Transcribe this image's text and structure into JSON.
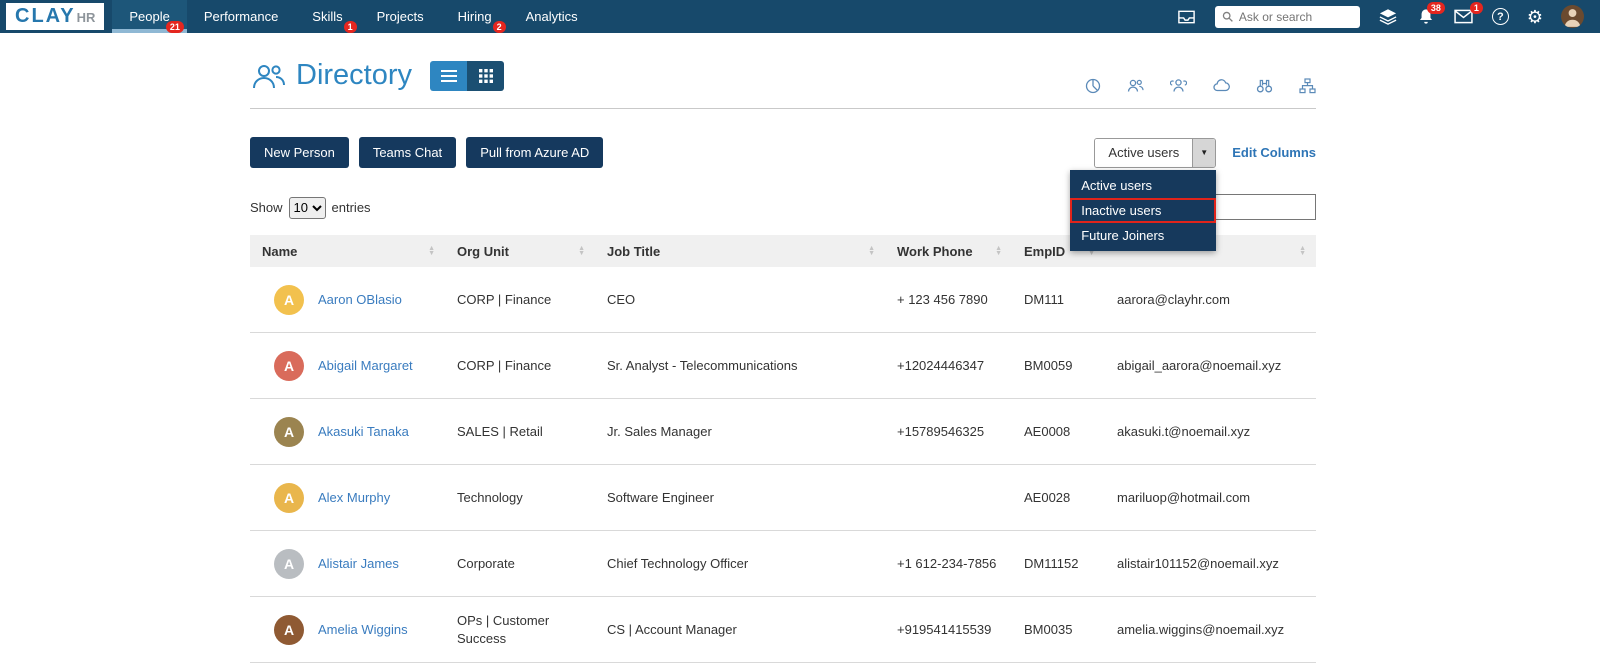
{
  "brand": {
    "name_main": "CLAY",
    "name_sub": "HR"
  },
  "nav": {
    "items": [
      {
        "label": "People",
        "badge": "21"
      },
      {
        "label": "Performance",
        "badge": ""
      },
      {
        "label": "Skills",
        "badge": "1"
      },
      {
        "label": "Projects",
        "badge": ""
      },
      {
        "label": "Hiring",
        "badge": "2"
      },
      {
        "label": "Analytics",
        "badge": ""
      }
    ]
  },
  "topbar": {
    "search_placeholder": "Ask or search",
    "notifications_badge": "38",
    "messages_badge": "1"
  },
  "page": {
    "title": "Directory"
  },
  "toolbar": {
    "new_person": "New Person",
    "teams_chat": "Teams Chat",
    "pull_azure": "Pull from Azure AD",
    "user_filter_value": "Active users",
    "edit_columns": "Edit Columns"
  },
  "filter_dropdown": {
    "items": [
      {
        "label": "Active users",
        "highlighted": false
      },
      {
        "label": "Inactive users",
        "highlighted": true
      },
      {
        "label": "Future Joiners",
        "highlighted": false
      }
    ],
    "highlight_color": "#e0241b"
  },
  "entries_bar": {
    "show": "Show",
    "entries": "entries",
    "page_size": "10"
  },
  "table": {
    "headers": [
      "Name",
      "Org Unit",
      "Job Title",
      "Work Phone",
      "EmpID",
      ""
    ],
    "rows": [
      {
        "name": "Aaron OBlasio",
        "initials": "A",
        "avatar_color": "#f2c14e",
        "org": "CORP | Finance",
        "job": "CEO",
        "phone": "+ 123 456 7890",
        "empid": "DM111",
        "email": "aarora@clayhr.com"
      },
      {
        "name": "Abigail Margaret",
        "initials": "A",
        "avatar_color": "#d96b5b",
        "org": "CORP | Finance",
        "job": "Sr. Analyst - Telecommunications",
        "phone": "+12024446347",
        "empid": "BM0059",
        "email": "abigail_aarora@noemail.xyz"
      },
      {
        "name": "Akasuki Tanaka",
        "initials": "A",
        "avatar_color": "#9b8450",
        "org": "SALES | Retail",
        "job": "Jr. Sales Manager",
        "phone": "+15789546325",
        "empid": "AE0008",
        "email": "akasuki.t@noemail.xyz"
      },
      {
        "name": "Alex Murphy",
        "initials": "A",
        "avatar_color": "#e9b64c",
        "org": "Technology",
        "job": "Software Engineer",
        "phone": "",
        "empid": "AE0028",
        "email": "mariluop@hotmail.com"
      },
      {
        "name": "Alistair James",
        "initials": "A",
        "avatar_color": "#b9bdc1",
        "org": "Corporate",
        "job": "Chief Technology Officer",
        "phone": "+1 612-234-7856",
        "empid": "DM11152",
        "email": "alistair101152@noemail.xyz"
      },
      {
        "name": "Amelia Wiggins",
        "initials": "A",
        "avatar_color": "#8f5a33",
        "org": "OPs | Customer Success",
        "job": "CS | Account Manager",
        "phone": "+919541415539",
        "empid": "BM0035",
        "email": "amelia.wiggins@noemail.xyz"
      }
    ]
  },
  "colors": {
    "topbar_bg": "#17496b",
    "accent_blue": "#2e86c1",
    "button_navy": "#15395e",
    "badge_red": "#e5261f"
  }
}
